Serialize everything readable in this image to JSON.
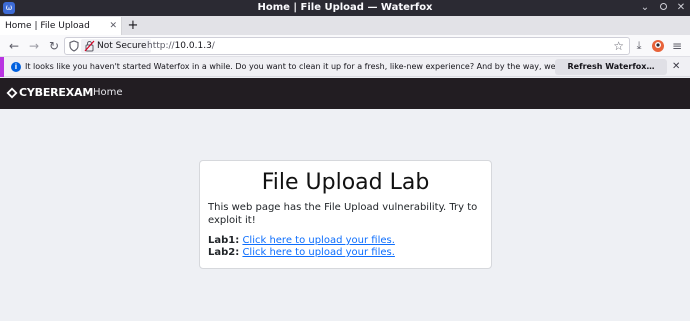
{
  "window": {
    "title": "Home | File Upload — Waterfox"
  },
  "tabs": [
    {
      "label": "Home | File Upload",
      "active": true
    }
  ],
  "navbar": {
    "security_label": "Not Secure",
    "url_prefix": "http://",
    "url_host": "10.0.1.3",
    "url_suffix": "/"
  },
  "notification": {
    "message": "It looks like you haven't started Waterfox in a while. Do you want to clean it up for a fresh, like-new experience? And by the way, welcome back!",
    "button_label": "Refresh Waterfox…"
  },
  "site": {
    "brand": "CYBEREXAM",
    "nav_home": "Home"
  },
  "card": {
    "title": "File Upload Lab",
    "description": "This web page has the File Upload vulnerability. Try to exploit it!",
    "labs": [
      {
        "label": "Lab1:",
        "link": "Click here to upload your files."
      },
      {
        "label": "Lab2:",
        "link": "Click here to upload your files."
      }
    ]
  },
  "colors": {
    "accent_notification": "#b833e1",
    "link": "#0d6efd",
    "site_nav_bg": "#221d22"
  }
}
